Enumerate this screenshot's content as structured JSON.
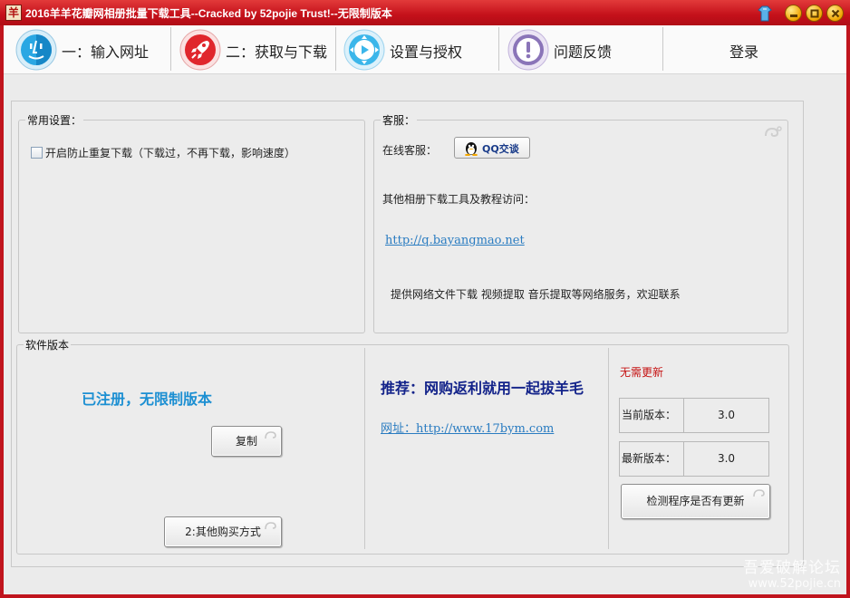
{
  "window": {
    "app_icon_char": "羊",
    "title": "2016羊羊花瓣网相册批量下载工具--Cracked by 52pojie Trust!--无限制版本"
  },
  "toolbar": {
    "items": [
      {
        "label": "一：输入网址",
        "icon": "finder-face-icon"
      },
      {
        "label": "二：获取与下载",
        "icon": "rocket-icon"
      },
      {
        "label": "设置与授权",
        "icon": "gamepad-icon"
      },
      {
        "label": "问题反馈",
        "icon": "exclamation-icon"
      },
      {
        "label": "登录"
      }
    ]
  },
  "common_settings": {
    "legend": "常用设置：",
    "dedupe_checkbox_label": "开启防止重复下载（下载过，不再下载，影响速度）",
    "dedupe_checked": false
  },
  "service": {
    "legend": "客服：",
    "online_label": "在线客服：",
    "qq_button_label": "QQ交谈",
    "tools_text": "其他相册下载工具及教程访问：",
    "site_link": "http://q.bayangmao.net",
    "services_text": "提供网络文件下载  视频提取   音乐提取等网络服务，欢迎联系"
  },
  "version": {
    "legend": "软件版本",
    "registered_text": "已注册，无限制版本",
    "copy_button": "复制",
    "buy_button": "2:其他购买方式",
    "recommend_text": "推荐：网购返利就用一起拔羊毛",
    "url_text": "网址：http://www.17bym.com",
    "update_status": "无需更新",
    "current_label": "当前版本：",
    "current_value": "3.0",
    "latest_label": "最新版本：",
    "latest_value": "3.0",
    "check_button": "检测程序是否有更新"
  },
  "watermark": {
    "cn": "吾爱破解论坛",
    "en": "www.52pojie.cn"
  },
  "colors": {
    "titlebar": "#c4101a",
    "registered": "#1c8fd2",
    "recommend": "#13238a",
    "no_update": "#c51010",
    "link": "#2a7cc1"
  }
}
